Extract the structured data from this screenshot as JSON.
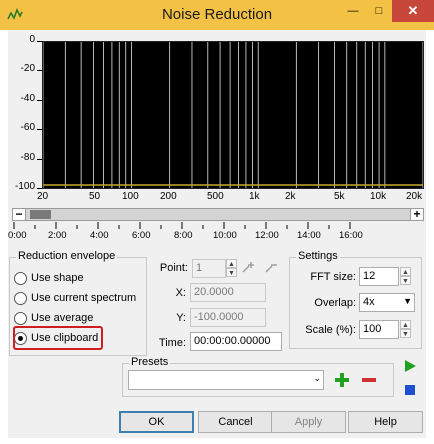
{
  "window": {
    "title": "Noise Reduction",
    "close_glyph": "✕",
    "minimize_glyph": "—",
    "maximize_glyph": "□"
  },
  "graph": {
    "y_labels": [
      "0",
      "-20",
      "-40",
      "-60",
      "-80",
      "-100"
    ],
    "x_labels": [
      "20",
      "50",
      "100",
      "200",
      "500",
      "1k",
      "2k",
      "5k",
      "10k",
      "20k"
    ],
    "line_color": "#c8a830",
    "grid_color": "#e6e6e6"
  },
  "scrollbar": {
    "minus": "−",
    "plus": "+"
  },
  "timeline": {
    "labels": [
      "0:00",
      "2:00",
      "4:00",
      "6:00",
      "8:00",
      "10:00",
      "12:00",
      "14:00",
      "16:00"
    ]
  },
  "envelope": {
    "title": "Reduction envelope",
    "options": [
      "Use shape",
      "Use current spectrum",
      "Use average",
      "Use clipboard"
    ],
    "selected": "Use clipboard"
  },
  "point": {
    "point_label": "Point:",
    "point_value": "1",
    "x_label": "X:",
    "x_value": "20.0000",
    "y_label": "Y:",
    "y_value": "-100.0000",
    "time_label": "Time:",
    "time_value": "00:00:00.00000"
  },
  "settings": {
    "title": "Settings",
    "fft_label": "FFT size:",
    "fft_value": "12",
    "overlap_label": "Overlap:",
    "overlap_value": "4x",
    "scale_label": "Scale (%):",
    "scale_value": "100"
  },
  "presets": {
    "title": "Presets",
    "selected": ""
  },
  "colors": {
    "accent_green": "#22a022",
    "accent_red": "#d03030",
    "accent_blue": "#1f4fd0",
    "title_bar": "#f3c245"
  },
  "buttons": {
    "ok": "OK",
    "cancel": "Cancel",
    "apply": "Apply",
    "help": "Help"
  }
}
